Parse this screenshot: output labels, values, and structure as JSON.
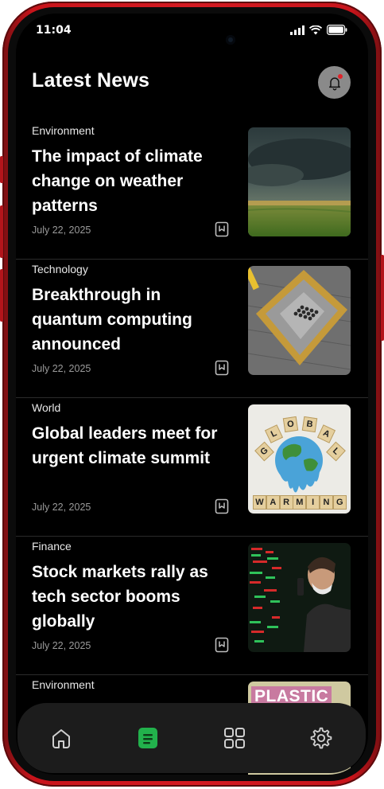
{
  "status": {
    "time": "11:04"
  },
  "header": {
    "title": "Latest News"
  },
  "articles": [
    {
      "category": "Environment",
      "title": "The impact of climate change on weather patterns",
      "date": "July 22, 2025",
      "image": "storm-over-field"
    },
    {
      "category": "Technology",
      "title": "Breakthrough in quantum computing announced",
      "date": "July 22, 2025",
      "image": "processor-chip"
    },
    {
      "category": "World",
      "title": "Global leaders meet for urgent climate summit",
      "date": "July 22, 2025",
      "image": "melting-globe"
    },
    {
      "category": "Finance",
      "title": "Stock markets rally as tech sector booms globally",
      "date": "July 22, 2025",
      "image": "trader-with-stock-board"
    },
    {
      "category": "Environment",
      "image_text": "PLASTIC",
      "image": "plastic-sign"
    }
  ],
  "thumb_text": {
    "global": [
      "G",
      "L",
      "O",
      "B",
      "A",
      "L"
    ],
    "warming": [
      "W",
      "A",
      "R",
      "M",
      "I",
      "N",
      "G"
    ]
  },
  "nav": {
    "items": [
      "home-icon",
      "news-icon",
      "dashboard-icon",
      "settings-icon"
    ],
    "active": "news-icon",
    "active_color": "#22b14c"
  }
}
